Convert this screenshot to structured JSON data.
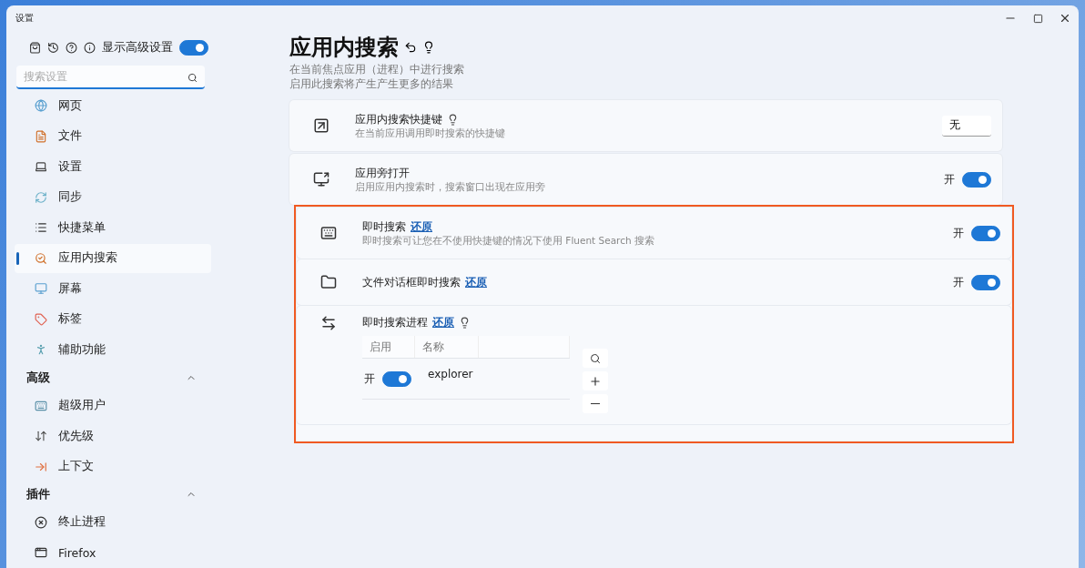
{
  "window": {
    "title": "设置"
  },
  "sidebar": {
    "advanced_toggle": {
      "label": "显示高级设置",
      "on": true
    },
    "search": {
      "placeholder": "搜索设置"
    },
    "items": [
      {
        "label": "网页",
        "selected": false
      },
      {
        "label": "文件",
        "selected": false
      },
      {
        "label": "设置",
        "selected": false
      },
      {
        "label": "同步",
        "selected": false
      },
      {
        "label": "快捷菜单",
        "selected": false
      },
      {
        "label": "应用内搜索",
        "selected": true
      },
      {
        "label": "屏幕",
        "selected": false
      },
      {
        "label": "标签",
        "selected": false
      },
      {
        "label": "辅助功能",
        "selected": false
      }
    ],
    "sections": [
      {
        "title": "高级",
        "expanded": true,
        "items": [
          {
            "label": "超级用户",
            "selected": false
          },
          {
            "label": "优先级",
            "selected": false
          },
          {
            "label": "上下文",
            "selected": false
          }
        ]
      },
      {
        "title": "插件",
        "expanded": true,
        "items": [
          {
            "label": "终止进程",
            "selected": false
          },
          {
            "label": "Firefox",
            "selected": false
          }
        ]
      }
    ]
  },
  "page": {
    "title": "应用内搜索",
    "description": [
      "在当前焦点应用（进程）中进行搜索",
      "启用此搜索将产生产生更多的结果"
    ]
  },
  "settings": [
    {
      "kind": "shortcut",
      "title": "应用内搜索快捷键",
      "hint": true,
      "subtitle": "在当前应用调用即时搜索的快捷键",
      "value": "无",
      "highlighted": false
    },
    {
      "kind": "toggle",
      "title": "应用旁打开",
      "subtitle": "启用应用内搜索时，搜索窗口出现在应用旁",
      "state": "开",
      "on": true,
      "highlighted": false
    },
    {
      "kind": "toggle",
      "title": "即时搜索",
      "reset": "还原",
      "subtitle": "即时搜索可让您在不使用快捷键的情况下使用 Fluent Search 搜索",
      "state": "开",
      "on": true,
      "highlighted": true
    },
    {
      "kind": "toggle",
      "title": "文件对话框即时搜索",
      "reset": "还原",
      "state": "开",
      "on": true,
      "highlighted": true
    },
    {
      "kind": "process-list",
      "title": "即时搜索进程",
      "reset": "还原",
      "hint": true,
      "highlighted": true,
      "table": {
        "columns": [
          "启用",
          "名称"
        ],
        "rows": [
          {
            "state": "开",
            "on": true,
            "name": "explorer"
          }
        ]
      }
    }
  ]
}
